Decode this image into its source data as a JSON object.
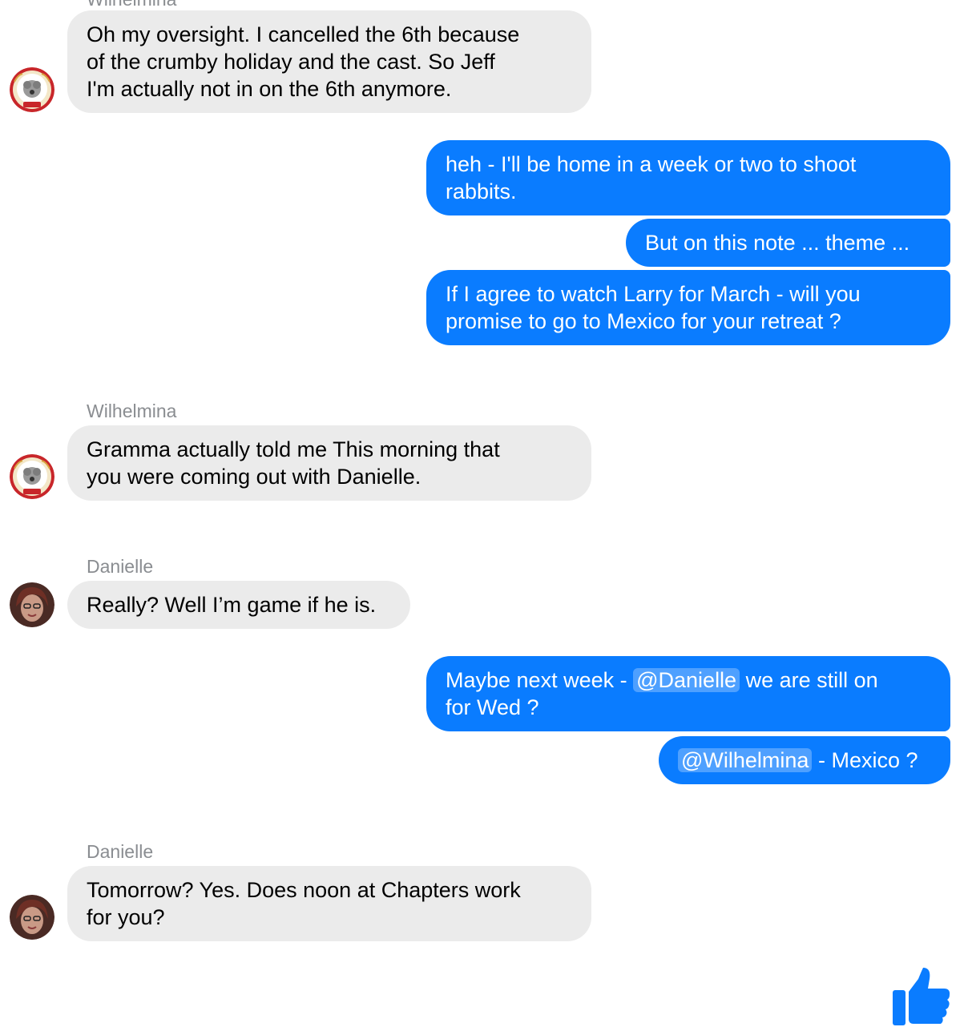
{
  "messages": {
    "m1": {
      "lines": [
        "Oh my oversight. I cancelled the 6th because",
        "of the crumby holiday and the cast.  So Jeff",
        "I'm actually not in on the 6th anymore."
      ]
    },
    "m2": {
      "lines": [
        "heh - I'll be home in a week or two to shoot",
        "rabbits."
      ]
    },
    "m3": {
      "text": "But on this note ... theme ..."
    },
    "m4": {
      "lines": [
        "If I agree to watch Larry for March - will you",
        "promise to go to Mexico for your retreat ?"
      ]
    },
    "m5": {
      "sender": "Wilhelmina",
      "lines": [
        "Gramma actually told me This morning that",
        "you were coming out with Danielle."
      ]
    },
    "m6": {
      "sender": "Danielle",
      "text": "Really? Well I’m game if he is."
    },
    "m7": {
      "pre": "Maybe next week - ",
      "mention": "@Danielle",
      "post": " we are still on",
      "line2": "for Wed ?"
    },
    "m8": {
      "mention": "@Wilhelmina",
      "post": " - Mexico ?"
    },
    "m9": {
      "sender": "Danielle",
      "lines": [
        "Tomorrow? Yes. Does noon at Chapters work",
        "for you?"
      ]
    }
  },
  "top_clipped_sender": "Wilhelmina",
  "colors": {
    "outgoing": "#0a7cff",
    "incoming": "#ebebeb",
    "sender": "#8a8d91"
  },
  "icons": {
    "like": "thumbs-up-icon"
  }
}
